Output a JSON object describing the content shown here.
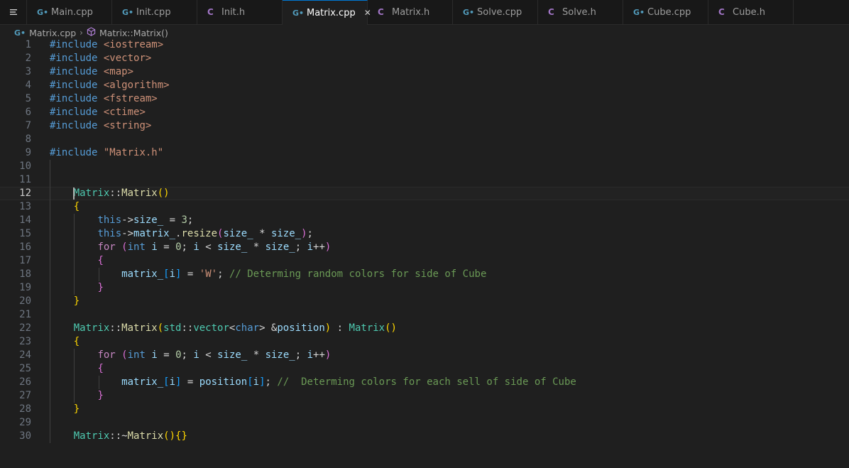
{
  "tabs": [
    {
      "label": "Main.cpp",
      "icon": "cpp-file-icon",
      "active": false
    },
    {
      "label": "Init.cpp",
      "icon": "cpp-file-icon",
      "active": false
    },
    {
      "label": "Init.h",
      "icon": "header-file-icon",
      "active": false
    },
    {
      "label": "Matrix.cpp",
      "icon": "cpp-file-icon",
      "active": true
    },
    {
      "label": "Matrix.h",
      "icon": "header-file-icon",
      "active": false
    },
    {
      "label": "Solve.cpp",
      "icon": "cpp-file-icon",
      "active": false
    },
    {
      "label": "Solve.h",
      "icon": "header-file-icon",
      "active": false
    },
    {
      "label": "Cube.cpp",
      "icon": "cpp-file-icon",
      "active": false
    },
    {
      "label": "Cube.h",
      "icon": "header-file-icon",
      "active": false
    }
  ],
  "icons": {
    "cpp": "G•",
    "header": "C",
    "close": "✕"
  },
  "breadcrumb": {
    "file": "Matrix.cpp",
    "symbol": "Matrix::Matrix()"
  },
  "colors": {
    "accent": "#0078d4",
    "background": "#1f1f1f",
    "tabbar": "#181818",
    "cpp_icon": "#519aba",
    "header_icon": "#a074c4"
  },
  "editor": {
    "current_line": 12,
    "lines": [
      {
        "n": "1",
        "t": [
          [
            "inc",
            "#include"
          ],
          [
            "op",
            " "
          ],
          [
            "str",
            "<iostream>"
          ]
        ]
      },
      {
        "n": "2",
        "t": [
          [
            "inc",
            "#include"
          ],
          [
            "op",
            " "
          ],
          [
            "str",
            "<vector>"
          ]
        ]
      },
      {
        "n": "3",
        "t": [
          [
            "inc",
            "#include"
          ],
          [
            "op",
            " "
          ],
          [
            "str",
            "<map>"
          ]
        ]
      },
      {
        "n": "4",
        "t": [
          [
            "inc",
            "#include"
          ],
          [
            "op",
            " "
          ],
          [
            "str",
            "<algorithm>"
          ]
        ]
      },
      {
        "n": "5",
        "t": [
          [
            "inc",
            "#include"
          ],
          [
            "op",
            " "
          ],
          [
            "str",
            "<fstream>"
          ]
        ]
      },
      {
        "n": "6",
        "t": [
          [
            "inc",
            "#include"
          ],
          [
            "op",
            " "
          ],
          [
            "str",
            "<ctime>"
          ]
        ]
      },
      {
        "n": "7",
        "t": [
          [
            "inc",
            "#include"
          ],
          [
            "op",
            " "
          ],
          [
            "str",
            "<string>"
          ]
        ]
      },
      {
        "n": "8",
        "t": []
      },
      {
        "n": "9",
        "t": [
          [
            "inc",
            "#include"
          ],
          [
            "op",
            " "
          ],
          [
            "str",
            "\"Matrix.h\""
          ]
        ]
      },
      {
        "n": "10",
        "t": []
      },
      {
        "n": "11",
        "t": []
      },
      {
        "n": "12",
        "t": [
          [
            "op",
            "    "
          ],
          [
            "type",
            "Matrix"
          ],
          [
            "op",
            "::"
          ],
          [
            "fn",
            "Matrix"
          ],
          [
            "b1",
            "()"
          ]
        ]
      },
      {
        "n": "13",
        "t": [
          [
            "op",
            "    "
          ],
          [
            "b1",
            "{"
          ]
        ]
      },
      {
        "n": "14",
        "t": [
          [
            "op",
            "        "
          ],
          [
            "kw",
            "this"
          ],
          [
            "op",
            "->"
          ],
          [
            "var",
            "size_"
          ],
          [
            "op",
            " = "
          ],
          [
            "num",
            "3"
          ],
          [
            "op",
            ";"
          ]
        ]
      },
      {
        "n": "15",
        "t": [
          [
            "op",
            "        "
          ],
          [
            "kw",
            "this"
          ],
          [
            "op",
            "->"
          ],
          [
            "var",
            "matrix_"
          ],
          [
            "op",
            "."
          ],
          [
            "fn",
            "resize"
          ],
          [
            "b2",
            "("
          ],
          [
            "var",
            "size_"
          ],
          [
            "op",
            " * "
          ],
          [
            "var",
            "size_"
          ],
          [
            "b2",
            ")"
          ],
          [
            "op",
            ";"
          ]
        ]
      },
      {
        "n": "16",
        "t": [
          [
            "op",
            "        "
          ],
          [
            "ctrl",
            "for"
          ],
          [
            "op",
            " "
          ],
          [
            "b2",
            "("
          ],
          [
            "kw",
            "int"
          ],
          [
            "op",
            " "
          ],
          [
            "var",
            "i"
          ],
          [
            "op",
            " = "
          ],
          [
            "num",
            "0"
          ],
          [
            "op",
            "; "
          ],
          [
            "var",
            "i"
          ],
          [
            "op",
            " < "
          ],
          [
            "var",
            "size_"
          ],
          [
            "op",
            " * "
          ],
          [
            "var",
            "size_"
          ],
          [
            "op",
            "; "
          ],
          [
            "var",
            "i"
          ],
          [
            "op",
            "++"
          ],
          [
            "b2",
            ")"
          ]
        ]
      },
      {
        "n": "17",
        "t": [
          [
            "op",
            "        "
          ],
          [
            "b2",
            "{"
          ]
        ]
      },
      {
        "n": "18",
        "t": [
          [
            "op",
            "            "
          ],
          [
            "var",
            "matrix_"
          ],
          [
            "b3",
            "["
          ],
          [
            "var",
            "i"
          ],
          [
            "b3",
            "]"
          ],
          [
            "op",
            " = "
          ],
          [
            "str",
            "'W'"
          ],
          [
            "op",
            "; "
          ],
          [
            "cm",
            "// Determing random colors for side of Cube"
          ]
        ]
      },
      {
        "n": "19",
        "t": [
          [
            "op",
            "        "
          ],
          [
            "b2",
            "}"
          ]
        ]
      },
      {
        "n": "20",
        "t": [
          [
            "op",
            "    "
          ],
          [
            "b1",
            "}"
          ]
        ]
      },
      {
        "n": "21",
        "t": []
      },
      {
        "n": "22",
        "t": [
          [
            "op",
            "    "
          ],
          [
            "type",
            "Matrix"
          ],
          [
            "op",
            "::"
          ],
          [
            "fn",
            "Matrix"
          ],
          [
            "b1",
            "("
          ],
          [
            "type",
            "std"
          ],
          [
            "op",
            "::"
          ],
          [
            "type",
            "vector"
          ],
          [
            "op",
            "<"
          ],
          [
            "kw",
            "char"
          ],
          [
            "op",
            "> &"
          ],
          [
            "var",
            "position"
          ],
          [
            "b1",
            ")"
          ],
          [
            "op",
            " : "
          ],
          [
            "type",
            "Matrix"
          ],
          [
            "b1",
            "()"
          ]
        ]
      },
      {
        "n": "23",
        "t": [
          [
            "op",
            "    "
          ],
          [
            "b1",
            "{"
          ]
        ]
      },
      {
        "n": "24",
        "t": [
          [
            "op",
            "        "
          ],
          [
            "ctrl",
            "for"
          ],
          [
            "op",
            " "
          ],
          [
            "b2",
            "("
          ],
          [
            "kw",
            "int"
          ],
          [
            "op",
            " "
          ],
          [
            "var",
            "i"
          ],
          [
            "op",
            " = "
          ],
          [
            "num",
            "0"
          ],
          [
            "op",
            "; "
          ],
          [
            "var",
            "i"
          ],
          [
            "op",
            " < "
          ],
          [
            "var",
            "size_"
          ],
          [
            "op",
            " * "
          ],
          [
            "var",
            "size_"
          ],
          [
            "op",
            "; "
          ],
          [
            "var",
            "i"
          ],
          [
            "op",
            "++"
          ],
          [
            "b2",
            ")"
          ]
        ]
      },
      {
        "n": "25",
        "t": [
          [
            "op",
            "        "
          ],
          [
            "b2",
            "{"
          ]
        ]
      },
      {
        "n": "26",
        "t": [
          [
            "op",
            "            "
          ],
          [
            "var",
            "matrix_"
          ],
          [
            "b3",
            "["
          ],
          [
            "var",
            "i"
          ],
          [
            "b3",
            "]"
          ],
          [
            "op",
            " = "
          ],
          [
            "var",
            "position"
          ],
          [
            "b3",
            "["
          ],
          [
            "var",
            "i"
          ],
          [
            "b3",
            "]"
          ],
          [
            "op",
            "; "
          ],
          [
            "cm",
            "//  Determing colors for each sell of side of Cube"
          ]
        ]
      },
      {
        "n": "27",
        "t": [
          [
            "op",
            "        "
          ],
          [
            "b2",
            "}"
          ]
        ]
      },
      {
        "n": "28",
        "t": [
          [
            "op",
            "    "
          ],
          [
            "b1",
            "}"
          ]
        ]
      },
      {
        "n": "29",
        "t": []
      },
      {
        "n": "30",
        "t": [
          [
            "op",
            "    "
          ],
          [
            "type",
            "Matrix"
          ],
          [
            "op",
            "::~"
          ],
          [
            "fn",
            "Matrix"
          ],
          [
            "b1",
            "(){}"
          ]
        ]
      }
    ]
  }
}
